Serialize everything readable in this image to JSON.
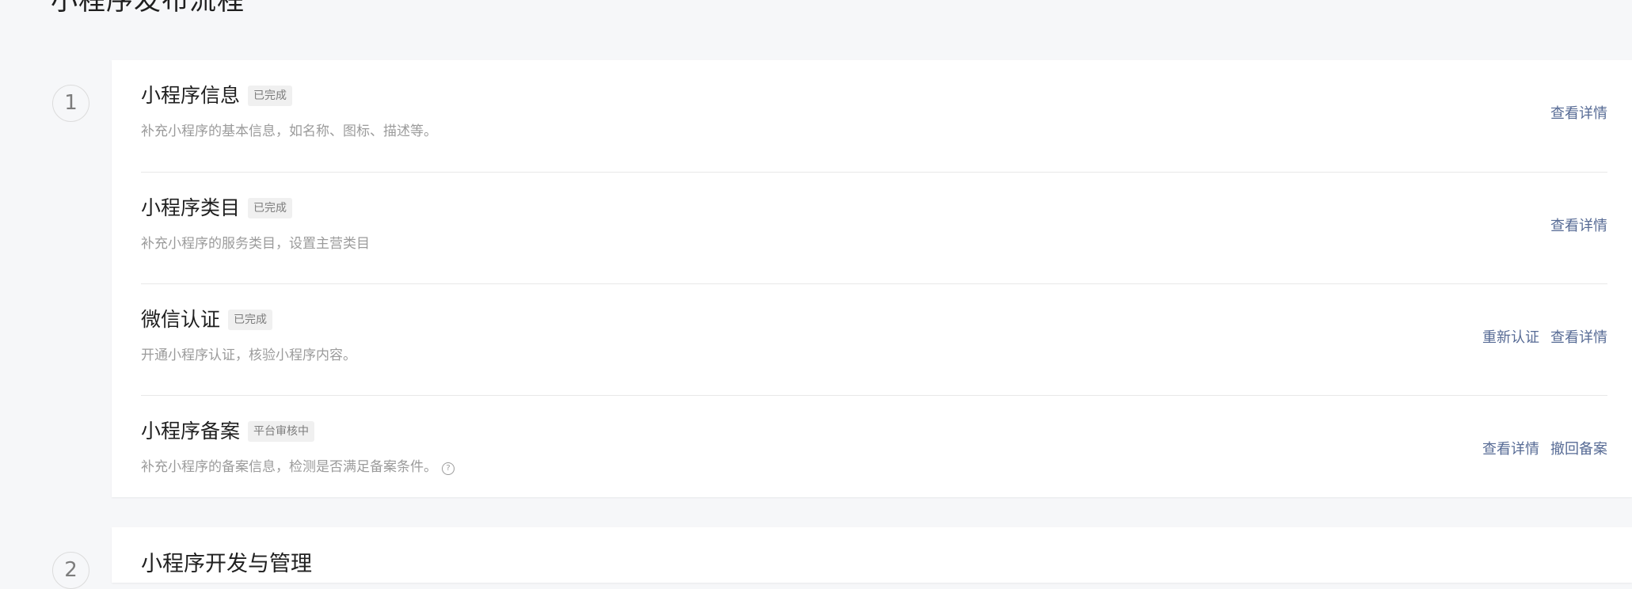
{
  "page": {
    "title": "小程序发布流程"
  },
  "steps": [
    {
      "number": "1",
      "rows": [
        {
          "title": "小程序信息",
          "badge": "已完成",
          "desc": "补充小程序的基本信息，如名称、图标、描述等。",
          "actions": [
            "查看详情"
          ]
        },
        {
          "title": "小程序类目",
          "badge": "已完成",
          "desc": "补充小程序的服务类目，设置主营类目",
          "actions": [
            "查看详情"
          ]
        },
        {
          "title": "微信认证",
          "badge": "已完成",
          "desc": "开通小程序认证，核验小程序内容。",
          "actions": [
            "重新认证",
            "查看详情"
          ]
        },
        {
          "title": "小程序备案",
          "badge": "平台审核中",
          "desc": "补充小程序的备案信息，检测是否满足备案条件。",
          "help_icon": "question-circle-icon",
          "actions": [
            "查看详情",
            "撤回备案"
          ]
        }
      ]
    },
    {
      "number": "2",
      "title": "小程序开发与管理"
    }
  ],
  "colors": {
    "background": "#f6f7f9",
    "card": "#ffffff",
    "link": "#576b95",
    "desc_text": "#9b9b9b",
    "badge_bg": "#f0f0f0"
  }
}
